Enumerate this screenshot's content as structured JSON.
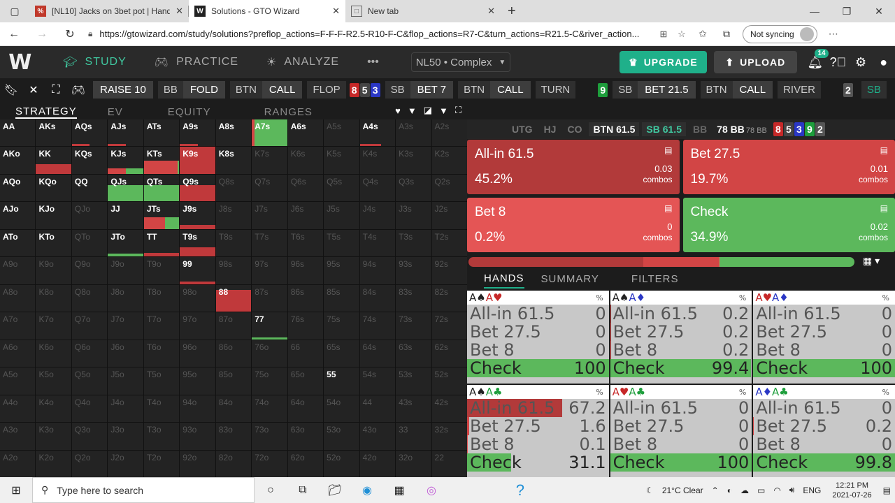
{
  "browser": {
    "tabs": [
      {
        "title": "[NL10] Jacks on 3bet pot | Hand",
        "icon": "poker-icon",
        "active": false
      },
      {
        "title": "Solutions - GTO Wizard",
        "icon": "w-icon",
        "active": true
      },
      {
        "title": "New tab",
        "icon": "newtab-icon",
        "active": false
      }
    ],
    "url": "https://gtowizard.com/study/solutions?preflop_actions=F-F-F-R2.5-R10-F-C&flop_actions=R7-C&turn_actions=R21.5-C&river_action...",
    "sync_label": "Not syncing"
  },
  "nav": {
    "logo": "W",
    "items": [
      {
        "label": "STUDY",
        "icon": "graduation-cap-icon",
        "active": true
      },
      {
        "label": "PRACTICE",
        "icon": "gamepad-icon",
        "active": false
      },
      {
        "label": "ANALYZE",
        "icon": "bulb-icon",
        "active": false
      }
    ],
    "more": "•••",
    "game_select": "NL50 • Complex",
    "upgrade": "UPGRADE",
    "upload": "UPLOAD",
    "notif_count": "14"
  },
  "action_bar": {
    "chips": [
      {
        "pos": "",
        "act": "RAISE 10"
      },
      {
        "pos": "BB",
        "act": "FOLD"
      },
      {
        "pos": "BTN",
        "act": "CALL"
      },
      {
        "pos": "FLOP",
        "act": ""
      },
      {
        "pos": "SB",
        "act": "BET 7"
      },
      {
        "pos": "BTN",
        "act": "CALL"
      },
      {
        "pos": "TURN",
        "act": ""
      },
      {
        "pos": "SB",
        "act": "BET 21.5"
      },
      {
        "pos": "BTN",
        "act": "CALL"
      },
      {
        "pos": "RIVER",
        "act": ""
      }
    ],
    "flop_cards": [
      {
        "r": "8",
        "c": "#c62828"
      },
      {
        "r": "5",
        "c": "#444"
      },
      {
        "r": "3",
        "c": "#2a37c5"
      }
    ],
    "turn_card": {
      "r": "9",
      "c": "#1e9e3c"
    },
    "river_card": {
      "r": "2",
      "c": "#555"
    },
    "tail": "SB"
  },
  "strategy_tabs": [
    "STRATEGY",
    "EV",
    "EQUITY",
    "RANGES"
  ],
  "matrix": [
    [
      "AA",
      "AKs",
      "AQs",
      "AJs",
      "ATs",
      "A9s",
      "A8s",
      "A7s",
      "A6s",
      "A5s",
      "A4s",
      "A3s",
      "A2s"
    ],
    [
      "AKo",
      "KK",
      "KQs",
      "KJs",
      "KTs",
      "K9s",
      "K8s",
      "K7s",
      "K6s",
      "K5s",
      "K4s",
      "K3s",
      "K2s"
    ],
    [
      "AQo",
      "KQo",
      "QQ",
      "QJs",
      "QTs",
      "Q9s",
      "Q8s",
      "Q7s",
      "Q6s",
      "Q5s",
      "Q4s",
      "Q3s",
      "Q2s"
    ],
    [
      "AJo",
      "KJo",
      "QJo",
      "JJ",
      "JTs",
      "J9s",
      "J8s",
      "J7s",
      "J6s",
      "J5s",
      "J4s",
      "J3s",
      "J2s"
    ],
    [
      "ATo",
      "KTo",
      "QTo",
      "JTo",
      "TT",
      "T9s",
      "T8s",
      "T7s",
      "T6s",
      "T5s",
      "T4s",
      "T3s",
      "T2s"
    ],
    [
      "A9o",
      "K9o",
      "Q9o",
      "J9o",
      "T9o",
      "99",
      "98s",
      "97s",
      "96s",
      "95s",
      "94s",
      "93s",
      "92s"
    ],
    [
      "A8o",
      "K8o",
      "Q8o",
      "J8o",
      "T8o",
      "98o",
      "88",
      "87s",
      "86s",
      "85s",
      "84s",
      "83s",
      "82s"
    ],
    [
      "A7o",
      "K7o",
      "Q7o",
      "J7o",
      "T7o",
      "97o",
      "87o",
      "77",
      "76s",
      "75s",
      "74s",
      "73s",
      "72s"
    ],
    [
      "A6o",
      "K6o",
      "Q6o",
      "J6o",
      "T6o",
      "96o",
      "86o",
      "76o",
      "66",
      "65s",
      "64s",
      "63s",
      "62s"
    ],
    [
      "A5o",
      "K5o",
      "Q5o",
      "J5o",
      "T5o",
      "95o",
      "85o",
      "75o",
      "65o",
      "55",
      "54s",
      "53s",
      "52s"
    ],
    [
      "A4o",
      "K4o",
      "Q4o",
      "J4o",
      "T4o",
      "94o",
      "84o",
      "74o",
      "64o",
      "54o",
      "44",
      "43s",
      "42s"
    ],
    [
      "A3o",
      "K3o",
      "Q3o",
      "J3o",
      "T3o",
      "93o",
      "83o",
      "73o",
      "63o",
      "53o",
      "43o",
      "33",
      "32s"
    ],
    [
      "A2o",
      "K2o",
      "Q2o",
      "J2o",
      "T2o",
      "92o",
      "82o",
      "72o",
      "62o",
      "52o",
      "42o",
      "32o",
      "22"
    ]
  ],
  "seats": {
    "list": [
      {
        "label": "UTG",
        "kind": "off"
      },
      {
        "label": "HJ",
        "kind": "off"
      },
      {
        "label": "CO",
        "kind": "off"
      },
      {
        "label": "BTN 61.5",
        "kind": "btn"
      },
      {
        "label": "SB 61.5",
        "kind": "sb"
      },
      {
        "label": "BB",
        "kind": "bb"
      }
    ],
    "pot": "78 BB",
    "pot_small": "78 BB",
    "board": [
      {
        "r": "8",
        "c": "#c62828"
      },
      {
        "r": "5",
        "c": "#444"
      },
      {
        "r": "3",
        "c": "#2a37c5"
      },
      {
        "r": "9",
        "c": "#1e9e3c"
      },
      {
        "r": "2",
        "c": "#555"
      }
    ]
  },
  "actions": [
    {
      "name": "All-in 61.5",
      "pct": "45.2%",
      "combos": "0.03",
      "unit": "combos",
      "color": "#b23a3a"
    },
    {
      "name": "Bet 27.5",
      "pct": "19.7%",
      "combos": "0.01",
      "unit": "combos",
      "color": "#d24545"
    },
    {
      "name": "Bet 8",
      "pct": "0.2%",
      "combos": "0",
      "unit": "combos",
      "color": "#e45555"
    },
    {
      "name": "Check",
      "pct": "34.9%",
      "combos": "0.02",
      "unit": "combos",
      "color": "#5cb85c"
    }
  ],
  "freq_bar": [
    {
      "value": 45.2,
      "color": "#b23a3a"
    },
    {
      "value": 19.7,
      "color": "#d24545"
    },
    {
      "value": 0.2,
      "color": "#e45555"
    },
    {
      "value": 34.9,
      "color": "#5cb85c"
    }
  ],
  "hand_tabs": [
    "HANDS",
    "SUMMARY",
    "FILTERS"
  ],
  "hands": [
    {
      "cards": [
        {
          "t": "A♠",
          "c": "#222"
        },
        {
          "t": "A♥",
          "c": "#c62828"
        }
      ],
      "rows": [
        [
          "All-in 61.5",
          "0"
        ],
        [
          "Bet 27.5",
          "0"
        ],
        [
          "Bet 8",
          "0"
        ],
        [
          "Check",
          "100"
        ]
      ]
    },
    {
      "cards": [
        {
          "t": "A♠",
          "c": "#222"
        },
        {
          "t": "A♦",
          "c": "#2a37c5"
        }
      ],
      "rows": [
        [
          "All-in 61.5",
          "0.2"
        ],
        [
          "Bet 27.5",
          "0.2"
        ],
        [
          "Bet 8",
          "0.2"
        ],
        [
          "Check",
          "99.4"
        ]
      ]
    },
    {
      "cards": [
        {
          "t": "A♥",
          "c": "#c62828"
        },
        {
          "t": "A♦",
          "c": "#2a37c5"
        }
      ],
      "rows": [
        [
          "All-in 61.5",
          "0"
        ],
        [
          "Bet 27.5",
          "0"
        ],
        [
          "Bet 8",
          "0"
        ],
        [
          "Check",
          "100"
        ]
      ]
    },
    {
      "cards": [
        {
          "t": "A♠",
          "c": "#222"
        },
        {
          "t": "A♣",
          "c": "#1e9e3c"
        }
      ],
      "rows": [
        [
          "All-in 61.5",
          "67.2"
        ],
        [
          "Bet 27.5",
          "1.6"
        ],
        [
          "Bet 8",
          "0.1"
        ],
        [
          "Check",
          "31.1"
        ]
      ]
    },
    {
      "cards": [
        {
          "t": "A♥",
          "c": "#c62828"
        },
        {
          "t": "A♣",
          "c": "#1e9e3c"
        }
      ],
      "rows": [
        [
          "All-in 61.5",
          "0"
        ],
        [
          "Bet 27.5",
          "0"
        ],
        [
          "Bet 8",
          "0"
        ],
        [
          "Check",
          "100"
        ]
      ]
    },
    {
      "cards": [
        {
          "t": "A♦",
          "c": "#2a37c5"
        },
        {
          "t": "A♣",
          "c": "#1e9e3c"
        }
      ],
      "rows": [
        [
          "All-in 61.5",
          "0"
        ],
        [
          "Bet 27.5",
          "0.2"
        ],
        [
          "Bet 8",
          "0"
        ],
        [
          "Check",
          "99.8"
        ]
      ]
    }
  ],
  "taskbar": {
    "search_placeholder": "Type here to search",
    "weather": "21°C  Clear",
    "lang": "ENG",
    "time": "12:21 PM",
    "date": "2021-07-26"
  }
}
